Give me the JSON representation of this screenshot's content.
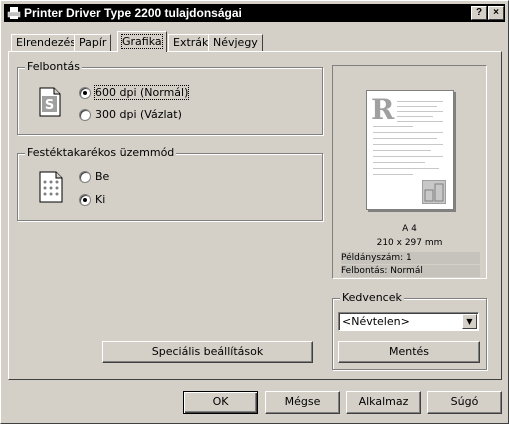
{
  "window": {
    "title": "Printer Driver Type 2200 tulajdonságai",
    "help_btn": "?",
    "close_btn": "×"
  },
  "tabs": [
    {
      "label": "Elrendezés"
    },
    {
      "label": "Papír"
    },
    {
      "label": "Grafika"
    },
    {
      "label": "Extrák"
    },
    {
      "label": "Névjegy"
    }
  ],
  "resolution": {
    "label": "Felbontás",
    "options": [
      {
        "label": "600 dpi (Normál)",
        "selected": true
      },
      {
        "label": "300 dpi (Vázlat)",
        "selected": false
      }
    ]
  },
  "toner_save": {
    "label": "Festéktakarékos üzemmód",
    "options": [
      {
        "label": "Be",
        "selected": false
      },
      {
        "label": "Ki",
        "selected": true
      }
    ]
  },
  "preview": {
    "page_letter": "R",
    "paper": "A 4",
    "size": "210 x 297 mm",
    "copies": "Példányszám: 1",
    "resolution": "Felbontás: Normál"
  },
  "favorites": {
    "label": "Kedvencek",
    "selected": "<Névtelen>",
    "save_button": "Mentés"
  },
  "special_button": "Speciális beállítások",
  "footer": {
    "ok": "OK",
    "cancel": "Mégse",
    "apply": "Alkalmaz",
    "help": "Súgó"
  },
  "icons": {
    "title": "printer-icon",
    "resolution": "s-document-icon",
    "toner": "dots-page-icon"
  }
}
